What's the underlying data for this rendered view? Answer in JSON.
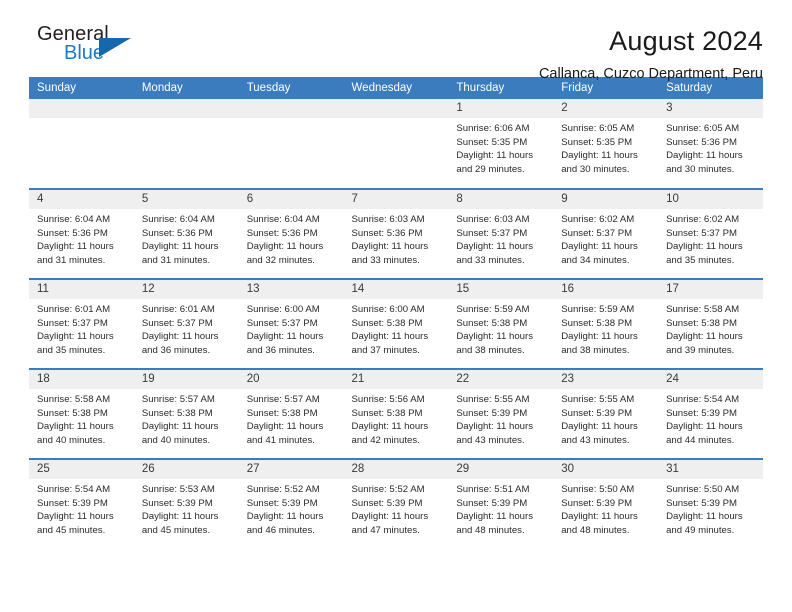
{
  "brand": {
    "name_top": "General",
    "name_bottom": "Blue",
    "accent_color": "#1e7ac4",
    "triangle_color": "#1668ad"
  },
  "header": {
    "title": "August 2024",
    "location": "Callanca, Cuzco Department, Peru",
    "header_bg": "#3a7cbe",
    "daynum_bg": "#efefef"
  },
  "weekday_headers": [
    "Sunday",
    "Monday",
    "Tuesday",
    "Wednesday",
    "Thursday",
    "Friday",
    "Saturday"
  ],
  "labels": {
    "sunrise_prefix": "Sunrise: ",
    "sunset_prefix": "Sunset: ",
    "daylight_prefix": "Daylight: "
  },
  "weeks": [
    [
      {
        "day": "",
        "blank": true,
        "line1": "",
        "line2": "",
        "line3": "",
        "line4": ""
      },
      {
        "day": "",
        "blank": true,
        "line1": "",
        "line2": "",
        "line3": "",
        "line4": ""
      },
      {
        "day": "",
        "blank": true,
        "line1": "",
        "line2": "",
        "line3": "",
        "line4": ""
      },
      {
        "day": "",
        "blank": true,
        "line1": "",
        "line2": "",
        "line3": "",
        "line4": ""
      },
      {
        "day": "1",
        "blank": false,
        "line1": "Sunrise: 6:06 AM",
        "line2": "Sunset: 5:35 PM",
        "line3": "Daylight: 11 hours",
        "line4": "and 29 minutes."
      },
      {
        "day": "2",
        "blank": false,
        "line1": "Sunrise: 6:05 AM",
        "line2": "Sunset: 5:35 PM",
        "line3": "Daylight: 11 hours",
        "line4": "and 30 minutes."
      },
      {
        "day": "3",
        "blank": false,
        "line1": "Sunrise: 6:05 AM",
        "line2": "Sunset: 5:36 PM",
        "line3": "Daylight: 11 hours",
        "line4": "and 30 minutes."
      }
    ],
    [
      {
        "day": "4",
        "blank": false,
        "line1": "Sunrise: 6:04 AM",
        "line2": "Sunset: 5:36 PM",
        "line3": "Daylight: 11 hours",
        "line4": "and 31 minutes."
      },
      {
        "day": "5",
        "blank": false,
        "line1": "Sunrise: 6:04 AM",
        "line2": "Sunset: 5:36 PM",
        "line3": "Daylight: 11 hours",
        "line4": "and 31 minutes."
      },
      {
        "day": "6",
        "blank": false,
        "line1": "Sunrise: 6:04 AM",
        "line2": "Sunset: 5:36 PM",
        "line3": "Daylight: 11 hours",
        "line4": "and 32 minutes."
      },
      {
        "day": "7",
        "blank": false,
        "line1": "Sunrise: 6:03 AM",
        "line2": "Sunset: 5:36 PM",
        "line3": "Daylight: 11 hours",
        "line4": "and 33 minutes."
      },
      {
        "day": "8",
        "blank": false,
        "line1": "Sunrise: 6:03 AM",
        "line2": "Sunset: 5:37 PM",
        "line3": "Daylight: 11 hours",
        "line4": "and 33 minutes."
      },
      {
        "day": "9",
        "blank": false,
        "line1": "Sunrise: 6:02 AM",
        "line2": "Sunset: 5:37 PM",
        "line3": "Daylight: 11 hours",
        "line4": "and 34 minutes."
      },
      {
        "day": "10",
        "blank": false,
        "line1": "Sunrise: 6:02 AM",
        "line2": "Sunset: 5:37 PM",
        "line3": "Daylight: 11 hours",
        "line4": "and 35 minutes."
      }
    ],
    [
      {
        "day": "11",
        "blank": false,
        "line1": "Sunrise: 6:01 AM",
        "line2": "Sunset: 5:37 PM",
        "line3": "Daylight: 11 hours",
        "line4": "and 35 minutes."
      },
      {
        "day": "12",
        "blank": false,
        "line1": "Sunrise: 6:01 AM",
        "line2": "Sunset: 5:37 PM",
        "line3": "Daylight: 11 hours",
        "line4": "and 36 minutes."
      },
      {
        "day": "13",
        "blank": false,
        "line1": "Sunrise: 6:00 AM",
        "line2": "Sunset: 5:37 PM",
        "line3": "Daylight: 11 hours",
        "line4": "and 36 minutes."
      },
      {
        "day": "14",
        "blank": false,
        "line1": "Sunrise: 6:00 AM",
        "line2": "Sunset: 5:38 PM",
        "line3": "Daylight: 11 hours",
        "line4": "and 37 minutes."
      },
      {
        "day": "15",
        "blank": false,
        "line1": "Sunrise: 5:59 AM",
        "line2": "Sunset: 5:38 PM",
        "line3": "Daylight: 11 hours",
        "line4": "and 38 minutes."
      },
      {
        "day": "16",
        "blank": false,
        "line1": "Sunrise: 5:59 AM",
        "line2": "Sunset: 5:38 PM",
        "line3": "Daylight: 11 hours",
        "line4": "and 38 minutes."
      },
      {
        "day": "17",
        "blank": false,
        "line1": "Sunrise: 5:58 AM",
        "line2": "Sunset: 5:38 PM",
        "line3": "Daylight: 11 hours",
        "line4": "and 39 minutes."
      }
    ],
    [
      {
        "day": "18",
        "blank": false,
        "line1": "Sunrise: 5:58 AM",
        "line2": "Sunset: 5:38 PM",
        "line3": "Daylight: 11 hours",
        "line4": "and 40 minutes."
      },
      {
        "day": "19",
        "blank": false,
        "line1": "Sunrise: 5:57 AM",
        "line2": "Sunset: 5:38 PM",
        "line3": "Daylight: 11 hours",
        "line4": "and 40 minutes."
      },
      {
        "day": "20",
        "blank": false,
        "line1": "Sunrise: 5:57 AM",
        "line2": "Sunset: 5:38 PM",
        "line3": "Daylight: 11 hours",
        "line4": "and 41 minutes."
      },
      {
        "day": "21",
        "blank": false,
        "line1": "Sunrise: 5:56 AM",
        "line2": "Sunset: 5:38 PM",
        "line3": "Daylight: 11 hours",
        "line4": "and 42 minutes."
      },
      {
        "day": "22",
        "blank": false,
        "line1": "Sunrise: 5:55 AM",
        "line2": "Sunset: 5:39 PM",
        "line3": "Daylight: 11 hours",
        "line4": "and 43 minutes."
      },
      {
        "day": "23",
        "blank": false,
        "line1": "Sunrise: 5:55 AM",
        "line2": "Sunset: 5:39 PM",
        "line3": "Daylight: 11 hours",
        "line4": "and 43 minutes."
      },
      {
        "day": "24",
        "blank": false,
        "line1": "Sunrise: 5:54 AM",
        "line2": "Sunset: 5:39 PM",
        "line3": "Daylight: 11 hours",
        "line4": "and 44 minutes."
      }
    ],
    [
      {
        "day": "25",
        "blank": false,
        "line1": "Sunrise: 5:54 AM",
        "line2": "Sunset: 5:39 PM",
        "line3": "Daylight: 11 hours",
        "line4": "and 45 minutes."
      },
      {
        "day": "26",
        "blank": false,
        "line1": "Sunrise: 5:53 AM",
        "line2": "Sunset: 5:39 PM",
        "line3": "Daylight: 11 hours",
        "line4": "and 45 minutes."
      },
      {
        "day": "27",
        "blank": false,
        "line1": "Sunrise: 5:52 AM",
        "line2": "Sunset: 5:39 PM",
        "line3": "Daylight: 11 hours",
        "line4": "and 46 minutes."
      },
      {
        "day": "28",
        "blank": false,
        "line1": "Sunrise: 5:52 AM",
        "line2": "Sunset: 5:39 PM",
        "line3": "Daylight: 11 hours",
        "line4": "and 47 minutes."
      },
      {
        "day": "29",
        "blank": false,
        "line1": "Sunrise: 5:51 AM",
        "line2": "Sunset: 5:39 PM",
        "line3": "Daylight: 11 hours",
        "line4": "and 48 minutes."
      },
      {
        "day": "30",
        "blank": false,
        "line1": "Sunrise: 5:50 AM",
        "line2": "Sunset: 5:39 PM",
        "line3": "Daylight: 11 hours",
        "line4": "and 48 minutes."
      },
      {
        "day": "31",
        "blank": false,
        "line1": "Sunrise: 5:50 AM",
        "line2": "Sunset: 5:39 PM",
        "line3": "Daylight: 11 hours",
        "line4": "and 49 minutes."
      }
    ]
  ]
}
